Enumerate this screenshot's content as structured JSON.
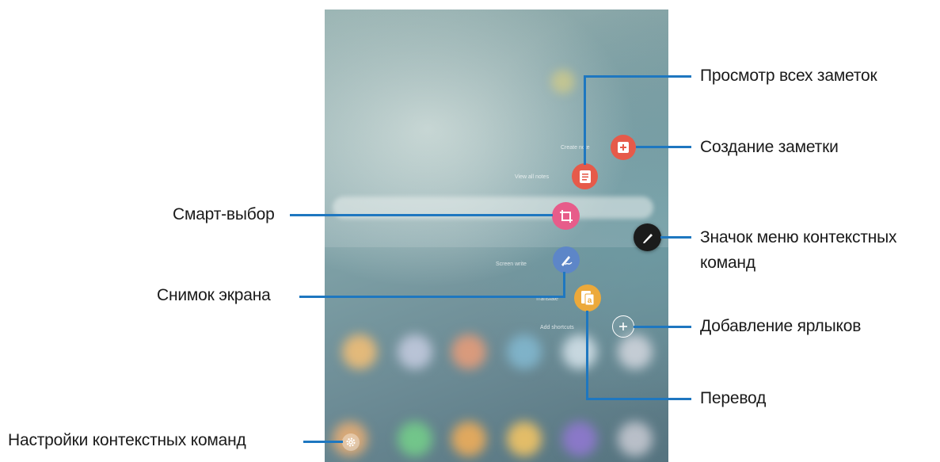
{
  "menu": {
    "items": {
      "view_all_notes": "View all notes",
      "create_note": "Create note",
      "screen_write": "Screen write",
      "translate": "Translate",
      "add_shortcuts": "Add shortcuts"
    }
  },
  "callouts": {
    "view_all_notes": "Просмотр всех заметок",
    "create_note": "Создание заметки",
    "smart_select": "Смарт-выбор",
    "air_command_icon_line1": "Значок меню контекстных",
    "air_command_icon_line2": "команд",
    "screen_write": "Снимок экрана",
    "add_shortcuts": "Добавление ярлыков",
    "translate": "Перевод",
    "air_command_settings": "Настройки контекстных команд"
  },
  "icons": {
    "create_note": "plus-note-icon",
    "view_all_notes": "notes-list-icon",
    "smart_select": "crop-select-icon",
    "screen_write": "pen-write-icon",
    "translate": "translate-icon",
    "air_command": "pen-icon",
    "add_shortcuts": "plus-icon",
    "settings": "gear-icon"
  },
  "colors": {
    "leader_line": "#1e77c0",
    "note_red": "#e65a4a",
    "smart_select_pink": "#e75c8a",
    "screen_write_blue": "#5d86c8",
    "translate_orange": "#eca93a",
    "air_command_dark": "#1b1b1b"
  }
}
